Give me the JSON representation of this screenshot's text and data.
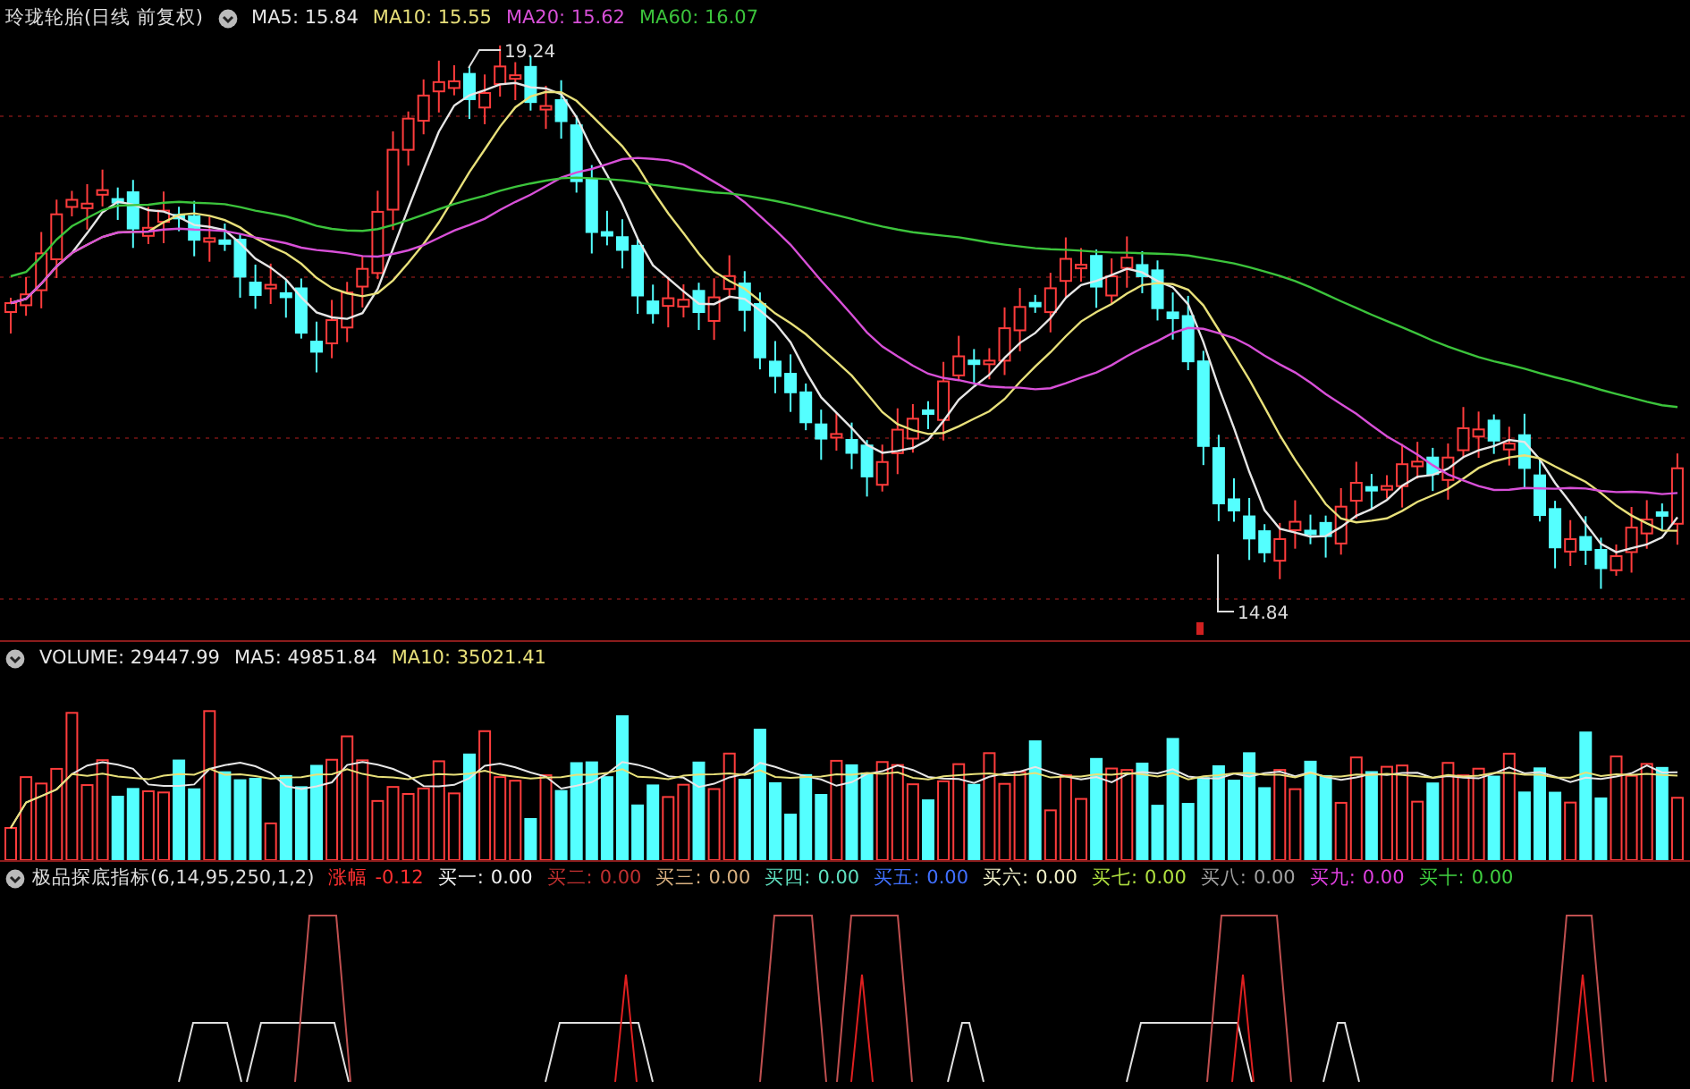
{
  "price_panel": {
    "title": "玲珑轮胎(日线 前复权)",
    "indicators": [
      {
        "label": "MA5: 15.84",
        "color": "#e6e6e6"
      },
      {
        "label": "MA10: 15.55",
        "color": "#e8e07a"
      },
      {
        "label": "MA20: 15.62",
        "color": "#d850d8"
      },
      {
        "label": "MA60: 16.07",
        "color": "#3cc43c"
      }
    ],
    "high_label": "19.24",
    "low_label": "14.84"
  },
  "volume_panel": {
    "indicators": [
      {
        "label": "VOLUME: 29447.99",
        "color": "#e6e6e6"
      },
      {
        "label": "MA5: 49851.84",
        "color": "#e6e6e6"
      },
      {
        "label": "MA10: 35021.41",
        "color": "#e8e07a"
      }
    ]
  },
  "signal_panel": {
    "title": "极品探底指标(6,14,95,250,1,2)",
    "indicators": [
      {
        "label": "涨幅",
        "value": "-0.12",
        "color": "#ff3030"
      },
      {
        "label": "买一:",
        "value": "0.00",
        "color": "#f0f0f0"
      },
      {
        "label": "买二:",
        "value": "0.00",
        "color": "#c03030"
      },
      {
        "label": "买三:",
        "value": "0.00",
        "color": "#d8b080"
      },
      {
        "label": "买四:",
        "value": "0.00",
        "color": "#60e0c0"
      },
      {
        "label": "买五:",
        "value": "0.00",
        "color": "#4070ff"
      },
      {
        "label": "买六:",
        "value": "0.00",
        "color": "#f0f0c8"
      },
      {
        "label": "买七:",
        "value": "0.00",
        "color": "#b0e040"
      },
      {
        "label": "买八:",
        "value": "0.00",
        "color": "#a0a0a0"
      },
      {
        "label": "买九:",
        "value": "0.00",
        "color": "#e040e0"
      },
      {
        "label": "买十:",
        "value": "0.00",
        "color": "#40d040"
      }
    ]
  }
}
